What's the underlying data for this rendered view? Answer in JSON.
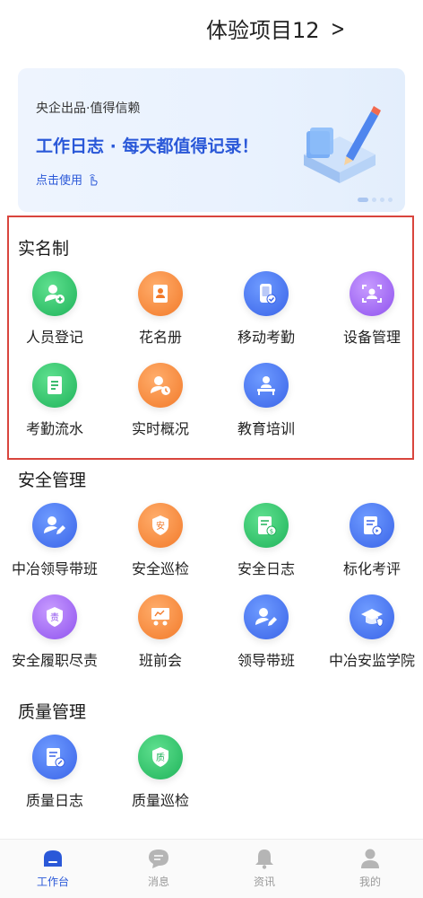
{
  "header": {
    "project_title": "体验项目12",
    "chevron": "chevron-right-icon"
  },
  "banner": {
    "subtitle": "央企出品·值得信赖",
    "headline": "工作日志 · 每天都值得记录！",
    "cta": "点击使用",
    "cta_icon": "tap-hand-icon",
    "page_count": 4,
    "active_page": 1
  },
  "sections": {
    "real_name": {
      "title": "实名制",
      "items": [
        {
          "label": "人员登记",
          "icon": "person-add-icon",
          "color": "green"
        },
        {
          "label": "花名册",
          "icon": "roster-icon",
          "color": "orange"
        },
        {
          "label": "移动考勤",
          "icon": "mobile-check-icon",
          "color": "blue"
        },
        {
          "label": "设备管理",
          "icon": "face-scan-icon",
          "color": "purple"
        },
        {
          "label": "考勤流水",
          "icon": "document-list-icon",
          "color": "green"
        },
        {
          "label": "实时概况",
          "icon": "person-clock-icon",
          "color": "orange"
        },
        {
          "label": "教育培训",
          "icon": "lecture-icon",
          "color": "blue"
        }
      ]
    },
    "safety": {
      "title": "安全管理",
      "items": [
        {
          "label": "中冶领导带班",
          "icon": "leader-edit-icon",
          "color": "blue"
        },
        {
          "label": "安全巡检",
          "icon": "safety-badge-icon",
          "color": "orange"
        },
        {
          "label": "安全日志",
          "icon": "safety-log-icon",
          "color": "green"
        },
        {
          "label": "标化考评",
          "icon": "evaluation-icon",
          "color": "blue"
        },
        {
          "label": "安全履职尽责",
          "icon": "duty-badge-icon",
          "color": "purple"
        },
        {
          "label": "班前会",
          "icon": "meeting-board-icon",
          "color": "orange"
        },
        {
          "label": "领导带班",
          "icon": "leader-edit-icon",
          "color": "blue"
        },
        {
          "label": "中冶安监学院",
          "icon": "graduation-cap-icon",
          "color": "blue"
        }
      ]
    },
    "quality": {
      "title": "质量管理",
      "items": [
        {
          "label": "质量日志",
          "icon": "quality-log-icon",
          "color": "blue"
        },
        {
          "label": "质量巡检",
          "icon": "quality-badge-icon",
          "color": "green"
        }
      ]
    }
  },
  "tabbar": [
    {
      "label": "工作台",
      "icon": "home-icon",
      "active": true
    },
    {
      "label": "消息",
      "icon": "chat-icon",
      "active": false
    },
    {
      "label": "资讯",
      "icon": "bell-icon",
      "active": false
    },
    {
      "label": "我的",
      "icon": "user-icon",
      "active": false
    }
  ],
  "colors": {
    "accent": "#2a58d8",
    "highlight_border": "#d9453d"
  }
}
